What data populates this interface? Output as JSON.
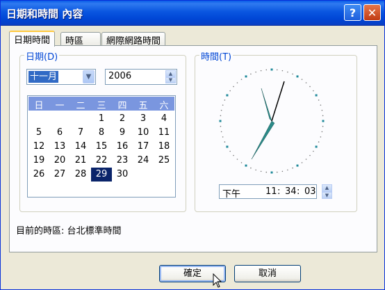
{
  "window": {
    "title": "日期和時間 內容"
  },
  "titlebar": {
    "help_label": "?",
    "close_label": "✕"
  },
  "tabs": [
    "日期時間",
    "時區",
    "網際網路時間"
  ],
  "date_group": {
    "label": "日期(D)",
    "month": "十一月",
    "year": "2006",
    "weekdays": [
      "日",
      "一",
      "二",
      "三",
      "四",
      "五",
      "六"
    ],
    "weeks": [
      [
        "",
        "",
        "",
        "1",
        "2",
        "3",
        "4"
      ],
      [
        "5",
        "6",
        "7",
        "8",
        "9",
        "10",
        "11"
      ],
      [
        "12",
        "13",
        "14",
        "15",
        "16",
        "17",
        "18"
      ],
      [
        "19",
        "20",
        "21",
        "22",
        "23",
        "24",
        "25"
      ],
      [
        "26",
        "27",
        "28",
        "29",
        "30",
        "",
        ""
      ]
    ],
    "selected_day": "29"
  },
  "time_group": {
    "label": "時間(T)",
    "ampm": "下午",
    "hour": "11",
    "minute": "34",
    "second": "03",
    "separator": ":"
  },
  "timezone": {
    "label": "目前的時區: 台北標準時間"
  },
  "buttons": {
    "ok": "確定",
    "cancel": "取消"
  },
  "colors": {
    "title_bar": "#0a56e0",
    "calendar_header": "#7a96df",
    "selection": "#0a246a",
    "group_label": "#0046d5",
    "clock_hand": "#2b8a88"
  }
}
